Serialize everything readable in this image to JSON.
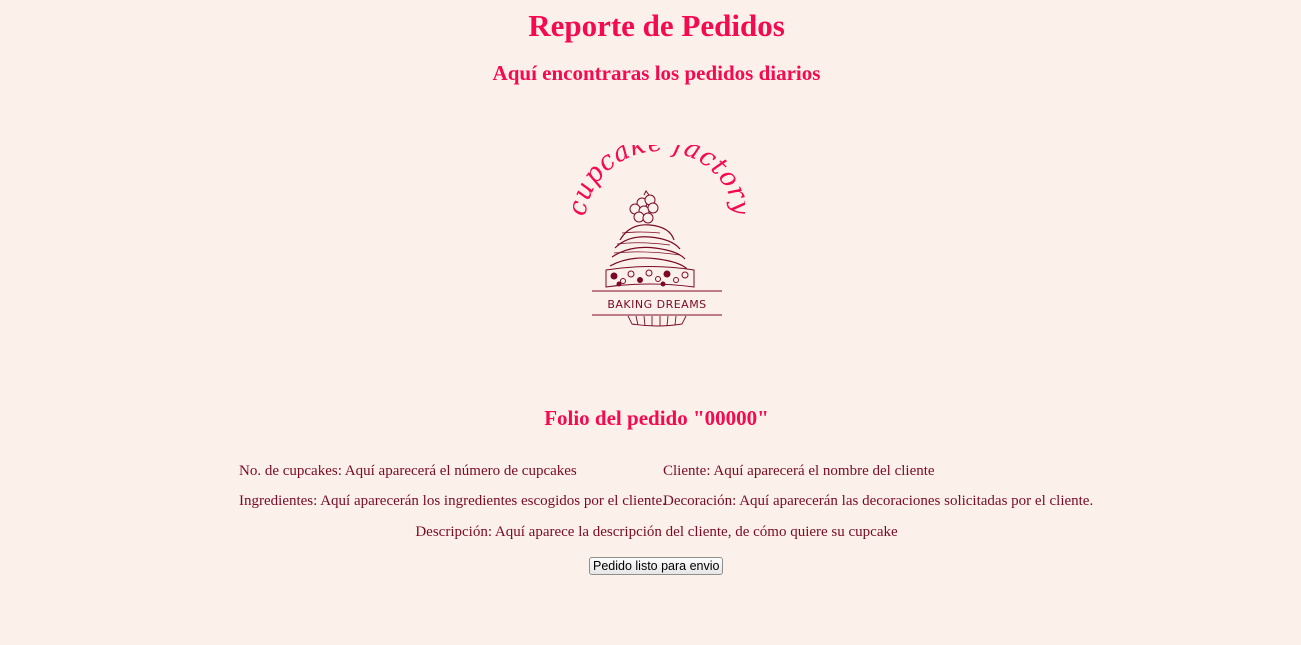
{
  "header": {
    "title": "Reporte de Pedidos",
    "subtitle": "Aquí encontraras los pedidos diarios"
  },
  "logo": {
    "brand_text": "cupcake factory",
    "tagline": "BAKING DREAMS",
    "colors": {
      "brand": "#f5094f",
      "illustration": "#7a0a24"
    }
  },
  "order": {
    "folio_prefix": "Folio del pedido ",
    "folio_number": "\"00000\"",
    "cupcakes_count": "No. de cupcakes: Aquí aparecerá el número de cupcakes",
    "client": "Cliente: Aquí aparecerá el nombre del cliente",
    "ingredients": "Ingredientes: Aquí aparecerán los ingredientes escogidos por el cliente.",
    "decoration": "Decoración: Aquí aparecerán las decoraciones solicitadas por el cliente.",
    "description": "Descripción: Aquí aparece la descripción del cliente, de cómo quiere su cupcake",
    "ready_button_label": "Pedido listo para envio"
  },
  "colors": {
    "background": "#fcf1ea",
    "heading": "#f5094f",
    "text": "#7a0a24"
  }
}
